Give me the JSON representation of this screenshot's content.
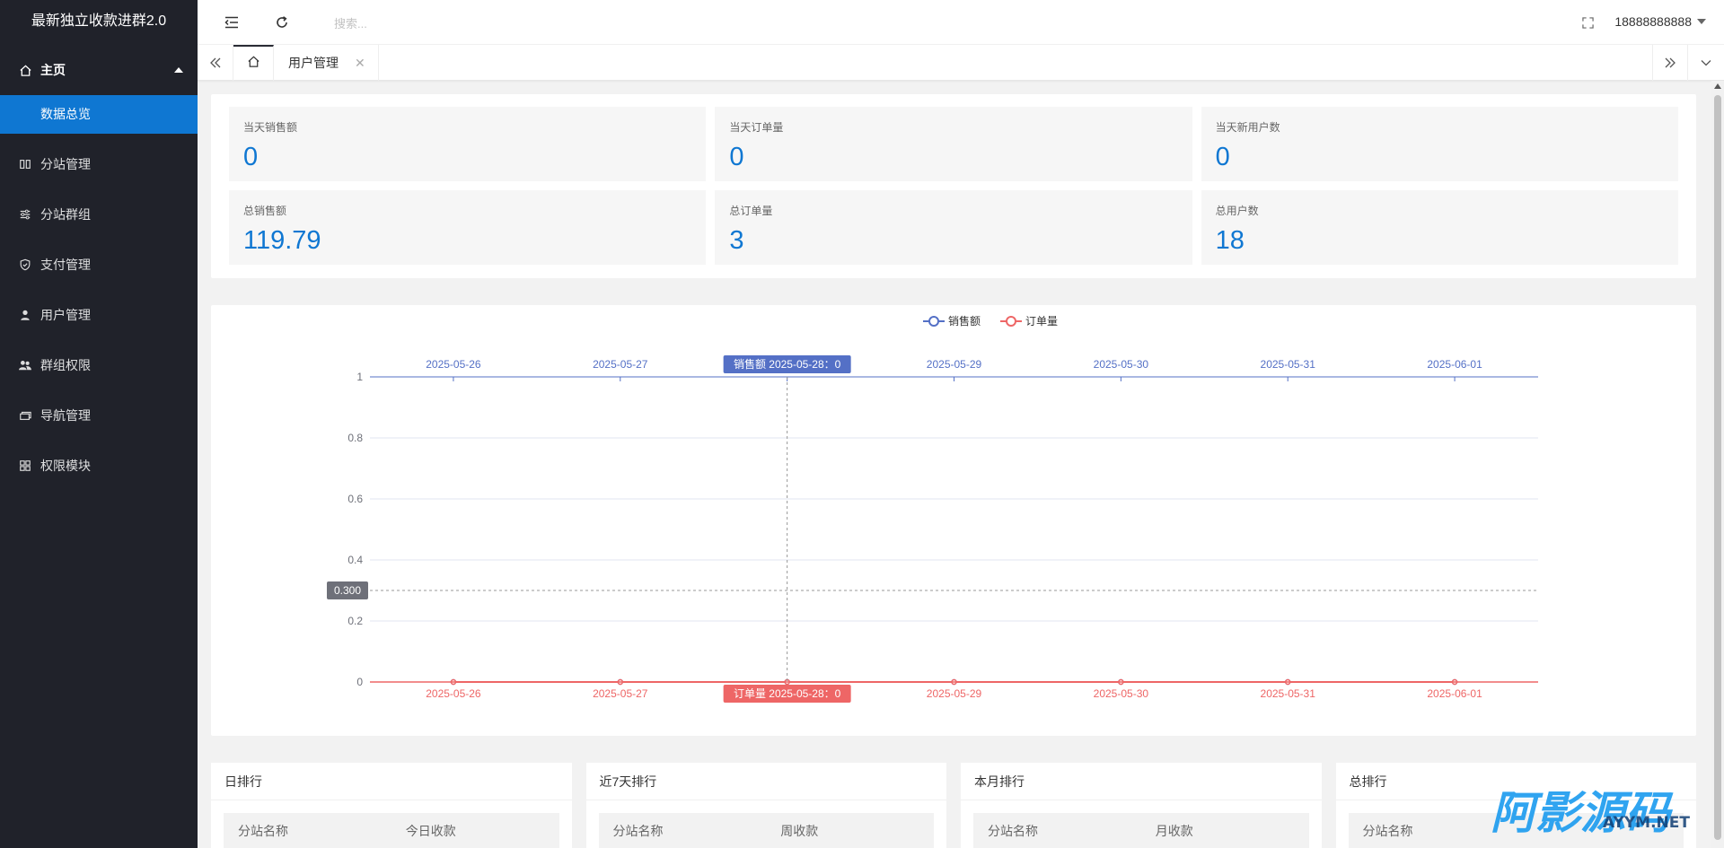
{
  "app": {
    "title": "最新独立收款进群2.0"
  },
  "sidebar": {
    "items": [
      {
        "label": "主页",
        "icon": "home-icon"
      },
      {
        "label": "数据总览",
        "icon": ""
      },
      {
        "label": "分站管理",
        "icon": "columns-icon"
      },
      {
        "label": "分站群组",
        "icon": "sliders-icon"
      },
      {
        "label": "支付管理",
        "icon": "shield-check-icon"
      },
      {
        "label": "用户管理",
        "icon": "user-icon"
      },
      {
        "label": "群组权限",
        "icon": "users-icon"
      },
      {
        "label": "导航管理",
        "icon": "nav-icon"
      },
      {
        "label": "权限模块",
        "icon": "grid-icon"
      }
    ]
  },
  "header": {
    "search_placeholder": "搜索...",
    "username": "18888888888"
  },
  "tabs": {
    "items": [
      {
        "label": "用户管理"
      }
    ]
  },
  "stats": [
    {
      "label": "当天销售额",
      "value": "0"
    },
    {
      "label": "当天订单量",
      "value": "0"
    },
    {
      "label": "当天新用户数",
      "value": "0"
    },
    {
      "label": "总销售额",
      "value": "119.79"
    },
    {
      "label": "总订单量",
      "value": "3"
    },
    {
      "label": "总用户数",
      "value": "18"
    }
  ],
  "chart_data": {
    "type": "line",
    "categories": [
      "2025-05-26",
      "2025-05-27",
      "2025-05-28",
      "2025-05-29",
      "2025-05-30",
      "2025-05-31",
      "2025-06-01"
    ],
    "series": [
      {
        "name": "销售额",
        "values": [
          0,
          0,
          0,
          0,
          0,
          0,
          0
        ],
        "color": "#5470c6"
      },
      {
        "name": "订单量",
        "values": [
          0,
          0,
          0,
          0,
          0,
          0,
          0
        ],
        "color": "#ee6666"
      }
    ],
    "y_ticks": [
      "0",
      "0.2",
      "0.4",
      "0.6",
      "0.8",
      "1"
    ],
    "ylim": [
      0,
      1
    ],
    "legend_position": "top-center",
    "tooltip": {
      "top_label": "销售额  2025-05-28：0",
      "bottom_label": "订单量  2025-05-28：0",
      "y_pointer": "0.300",
      "y_pointer_value": 0.3,
      "category_index": 2
    }
  },
  "rankings": [
    {
      "title": "日排行",
      "col1": "分站名称",
      "col2": "今日收款"
    },
    {
      "title": "近7天排行",
      "col1": "分站名称",
      "col2": "周收款"
    },
    {
      "title": "本月排行",
      "col1": "分站名称",
      "col2": "月收款"
    },
    {
      "title": "总排行",
      "col1": "分站名称",
      "col2": ""
    }
  ],
  "watermark": {
    "text": "阿影源码",
    "sub": "AYYM.NET"
  }
}
